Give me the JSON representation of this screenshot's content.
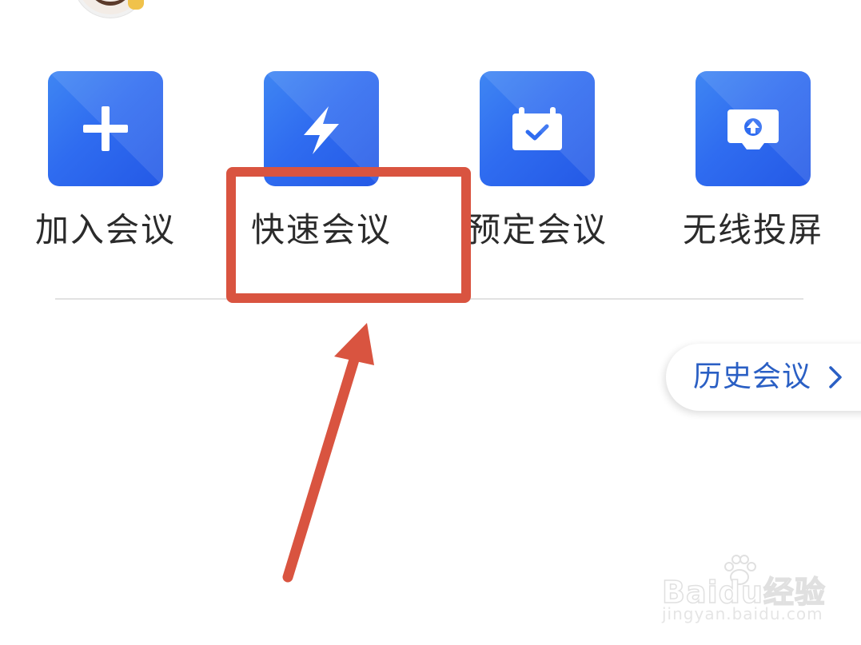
{
  "actions": [
    {
      "id": "join",
      "label": "加入会议",
      "icon": "plus-icon"
    },
    {
      "id": "quick",
      "label": "快速会议",
      "icon": "lightning-icon"
    },
    {
      "id": "schedule",
      "label": "预定会议",
      "icon": "calendar-check-icon"
    },
    {
      "id": "cast",
      "label": "无线投屏",
      "icon": "screen-upload-icon"
    }
  ],
  "history": {
    "label": "历史会议",
    "icon": "chevron-right-icon"
  },
  "annotation": {
    "highlight_target": "快速会议",
    "color": "#d95440"
  },
  "watermark": {
    "main": "Baidu经验",
    "sub": "jingyan.baidu.com"
  },
  "colors": {
    "tile_blue": "#2f6cf0",
    "history_text": "#2a5fc4",
    "label_text": "#2b2b2b"
  }
}
